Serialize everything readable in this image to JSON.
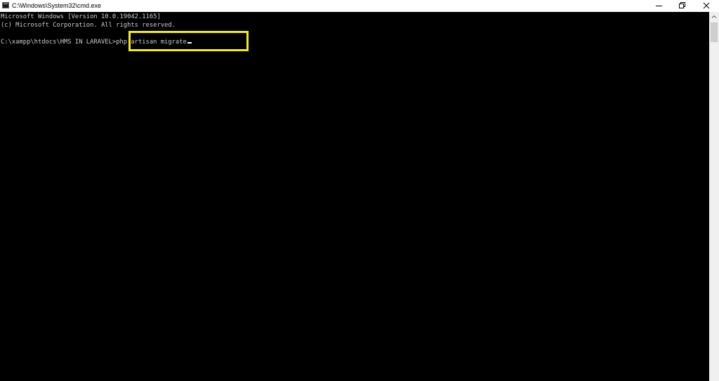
{
  "window": {
    "title": "C:\\Windows\\System32\\cmd.exe",
    "icon": "cmd-icon"
  },
  "caption_buttons": {
    "minimize": "minimize-icon",
    "restore": "restore-icon",
    "close": "close-icon"
  },
  "console": {
    "lines": [
      "Microsoft Windows [Version 10.0.19042.1165]",
      "(c) Microsoft Corporation. All rights reserved.",
      ""
    ],
    "prompt": "C:\\xampp\\htdocs\\HMS IN LARAVEL>",
    "command": "php artisan migrate"
  },
  "highlight": {
    "color": "#f5ec1b"
  },
  "colors": {
    "console_background": "#000000",
    "console_text": "#cccccc"
  }
}
